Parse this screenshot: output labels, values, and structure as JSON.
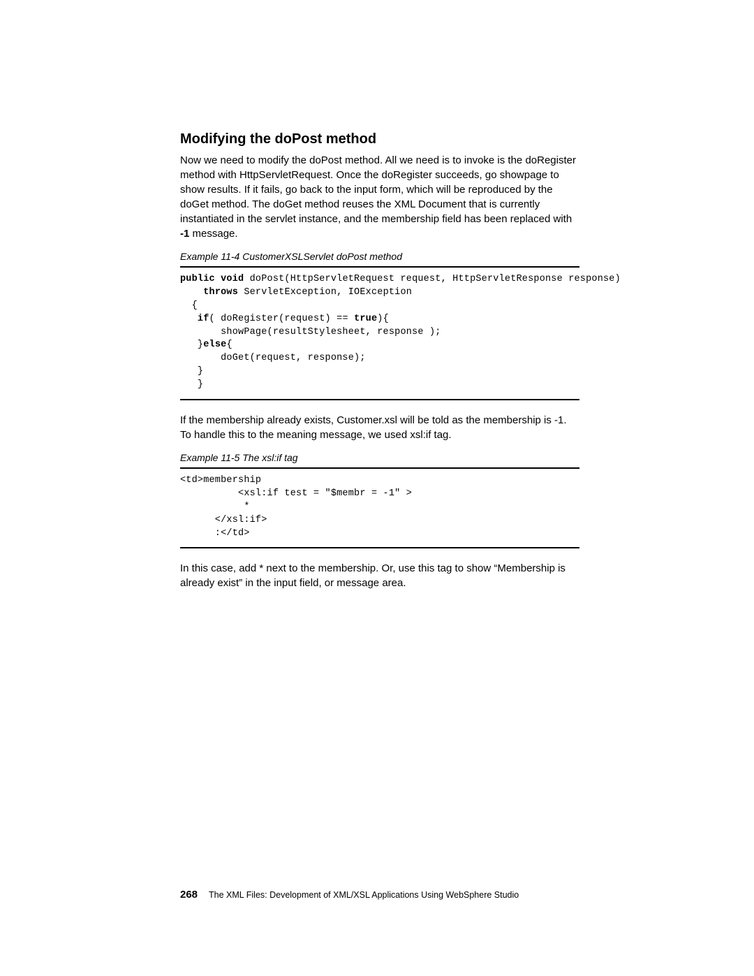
{
  "heading": "Modifying the doPost method",
  "paragraph1_part1": "Now we need to modify the doPost method. All we need is to invoke is the doRegister method with HttpServletRequest. Once the doRegister succeeds, go showpage to show results. If it fails, go back to the input form, which will be reproduced by the doGet method. The doGet method reuses the XML Document that is currently instantiated in the servlet instance, and the membership field has been replaced with ",
  "paragraph1_bold": "-1",
  "paragraph1_part2": " message.",
  "example1_caption": "Example 11-4   CustomerXSLServlet doPost method",
  "code1": {
    "k1": "public void",
    "t1": " doPost(HttpServletRequest request, HttpServletResponse response)",
    "k2": "throws",
    "t2": " ServletException, IOException",
    "l3": "  {",
    "k3": "if",
    "t3": "( doRegister(request) == ",
    "k4": "true",
    "t4": "){",
    "l5": "       showPage(resultStylesheet, response );",
    "l6a": "   }",
    "k5": "else",
    "l6b": "{",
    "l7": "       doGet(request, response);",
    "l8": "   }",
    "l9": "   }"
  },
  "paragraph2": "If the membership already exists, Customer.xsl will be told as the membership is -1. To handle this to the meaning message, we used xsl:if tag.",
  "example2_caption": "Example 11-5   The xsl:if tag",
  "code2": {
    "l1": "<td>membership",
    "l2": "          <xsl:if test = \"$membr = -1\" >",
    "l3": "           *",
    "l4": "      </xsl:if>",
    "l5": "      :</td>"
  },
  "paragraph3": "In this case, add * next to the membership. Or, use this tag to show “Membership is already exist” in the input field, or message area.",
  "footer": {
    "page": "268",
    "title": "The XML Files:   Development of XML/XSL Applications Using WebSphere Studio"
  }
}
